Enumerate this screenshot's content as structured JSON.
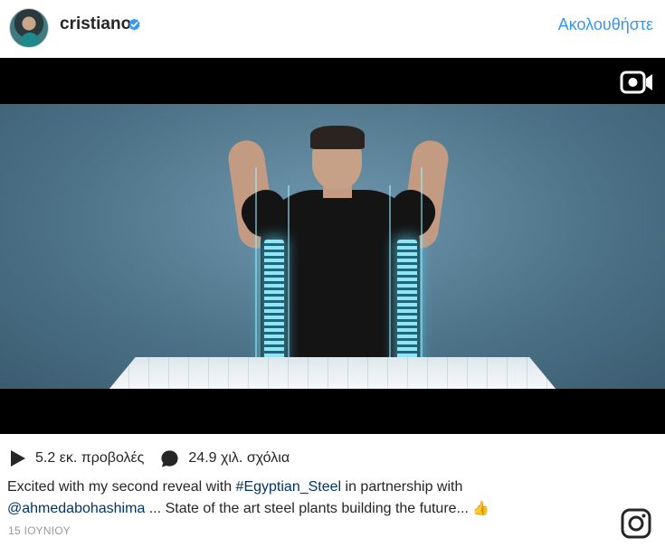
{
  "header": {
    "username": "cristiano",
    "avatar_icon": "profile-avatar",
    "verified_icon": "verified-badge-icon",
    "follow_label": "Ακολουθήστε",
    "accent_color": "#3897f0"
  },
  "media": {
    "type_icon": "video-camera-icon"
  },
  "stats": {
    "views": "5.2 εκ. προβολές",
    "comments": "24.9 χιλ. σχόλια"
  },
  "caption": {
    "part1": "Excited with my second reveal with ",
    "hashtag": "#Egyptian_Steel",
    "part2": " in partnership with",
    "mention": "@ahmedabohashima",
    "part3": " ... State of the art steel plants building the future... ",
    "emoji": "👍"
  },
  "date": "15 ΙΟΥΝΙΟΥ",
  "footer_icon": "instagram-logo-icon"
}
